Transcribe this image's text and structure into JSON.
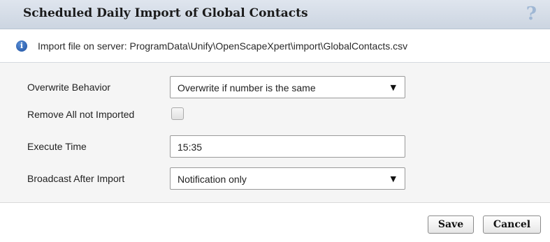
{
  "dialog": {
    "title": "Scheduled Daily Import of Global Contacts",
    "help_label": "?"
  },
  "info": {
    "icon": "info-icon",
    "glyph": "i",
    "text": "Import file on server: ProgramData\\Unify\\OpenScapeXpert\\import\\GlobalContacts.csv"
  },
  "form": {
    "overwrite": {
      "label": "Overwrite Behavior",
      "value": "Overwrite if number is the same",
      "arrow": "▼"
    },
    "remove": {
      "label": "Remove All not Imported",
      "checked": false
    },
    "execute_time": {
      "label": "Execute Time",
      "value": "15:35"
    },
    "broadcast": {
      "label": "Broadcast After Import",
      "value": "Notification only",
      "arrow": "▼"
    }
  },
  "footer": {
    "save_label": "Save",
    "cancel_label": "Cancel"
  },
  "colors": {
    "header_bg": "#d5dce6",
    "help_color": "#9fb7d4",
    "form_bg": "#f5f5f5"
  }
}
